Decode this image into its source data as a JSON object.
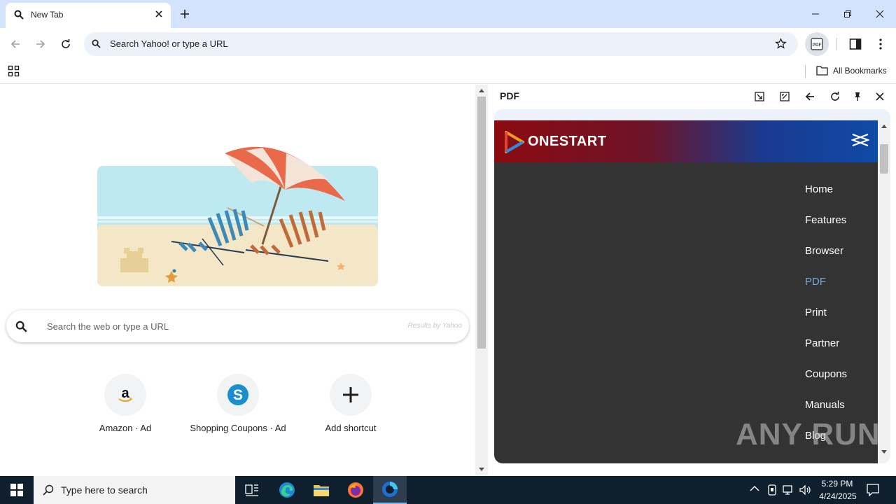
{
  "browser": {
    "tab_title": "New Tab",
    "omnibox_placeholder": "Search Yahoo! or type a URL",
    "all_bookmarks_label": "All Bookmarks"
  },
  "ntp": {
    "search_placeholder": "Search the web or type a URL",
    "search_attribution": "Results by Yahoo",
    "shortcuts": [
      {
        "label": "Amazon · Ad",
        "icon": "amazon-icon"
      },
      {
        "label": "Shopping Coupons · Ad",
        "icon": "shopping-coupons-icon"
      },
      {
        "label": "Add shortcut",
        "icon": "plus-icon"
      }
    ]
  },
  "side_panel": {
    "title": "PDF",
    "brand": "ONESTART",
    "menu": [
      {
        "label": "Home",
        "active": false
      },
      {
        "label": "Features",
        "active": false
      },
      {
        "label": "Browser",
        "active": false
      },
      {
        "label": "PDF",
        "active": true
      },
      {
        "label": "Print",
        "active": false
      },
      {
        "label": "Partner",
        "active": false
      },
      {
        "label": "Coupons",
        "active": false
      },
      {
        "label": "Manuals",
        "active": false
      },
      {
        "label": "Blog",
        "active": false
      }
    ],
    "watermark": "ANY RUN"
  },
  "taskbar": {
    "search_placeholder": "Type here to search",
    "time": "5:29 PM",
    "date": "4/24/2025"
  },
  "colors": {
    "tabstrip": "#d3e3fd",
    "omnibox": "#edf2fa",
    "menu_bg": "#333333",
    "menu_active": "#6fa8dc",
    "taskbar": "#0f1f2e"
  }
}
